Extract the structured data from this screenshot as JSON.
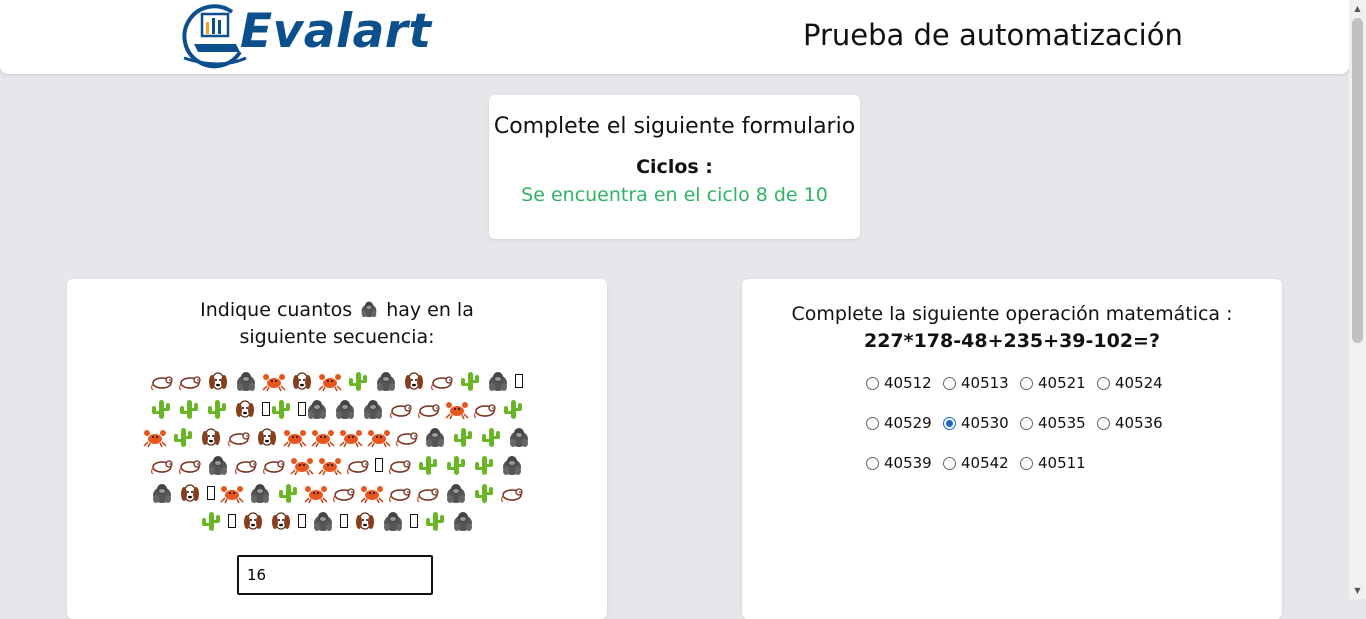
{
  "header": {
    "logo_text": "Evalart",
    "title": "Prueba de automatización"
  },
  "status_card": {
    "title": "Complete el siguiente formulario",
    "cycles_label": "Ciclos :",
    "cycles_status": "Se encuentra en el ciclo 8 de 10"
  },
  "emoji_question": {
    "prefix": "Indique cuantos",
    "target_icon": "gorilla-icon",
    "suffix": "hay en la siguiente secuencia:",
    "rows": [
      [
        "rat",
        "rat",
        "dog",
        "gorilla",
        "crab",
        "dog",
        "crab",
        "cactus",
        "gorilla",
        "dog",
        "rat",
        "cactus",
        "gorilla",
        "unknown"
      ],
      [
        "cactus",
        "cactus",
        "cactus",
        "dog",
        "unknown",
        "cactus",
        "unknown",
        "gorilla",
        "gorilla",
        "gorilla",
        "rat",
        "rat",
        "crab",
        "rat",
        "cactus"
      ],
      [
        "crab",
        "cactus",
        "dog",
        "rat",
        "dog",
        "crab",
        "crab",
        "crab",
        "crab",
        "rat",
        "gorilla",
        "cactus",
        "cactus",
        "gorilla"
      ],
      [
        "rat",
        "rat",
        "gorilla",
        "rat",
        "rat",
        "crab",
        "crab",
        "rat",
        "unknown",
        "rat",
        "cactus",
        "cactus",
        "cactus",
        "gorilla"
      ],
      [
        "gorilla",
        "dog",
        "unknown",
        "crab",
        "gorilla",
        "cactus",
        "crab",
        "rat",
        "crab",
        "rat",
        "rat",
        "gorilla",
        "cactus",
        "rat"
      ],
      [
        "cactus",
        "unknown",
        "dog",
        "dog",
        "unknown",
        "gorilla",
        "unknown",
        "dog",
        "gorilla",
        "unknown",
        "cactus",
        "gorilla"
      ]
    ],
    "answer_value": "16"
  },
  "math_question": {
    "prompt": "Complete la siguiente operación matemática :",
    "expression": "227*178-48+235+39-102=?",
    "options": [
      [
        {
          "label": "40512",
          "checked": false
        },
        {
          "label": "40513",
          "checked": false
        },
        {
          "label": "40521",
          "checked": false
        },
        {
          "label": "40524",
          "checked": false
        }
      ],
      [
        {
          "label": "40529",
          "checked": false
        },
        {
          "label": "40530",
          "checked": true
        },
        {
          "label": "40535",
          "checked": false
        },
        {
          "label": "40536",
          "checked": false
        }
      ],
      [
        {
          "label": "40539",
          "checked": false
        },
        {
          "label": "40542",
          "checked": false
        },
        {
          "label": "40511",
          "checked": false
        }
      ]
    ]
  },
  "colors": {
    "background": "#e5e7eb",
    "status_green": "#2fb466",
    "brand_blue": "#0b4f8c",
    "radio_selected": "#1a66d2"
  }
}
